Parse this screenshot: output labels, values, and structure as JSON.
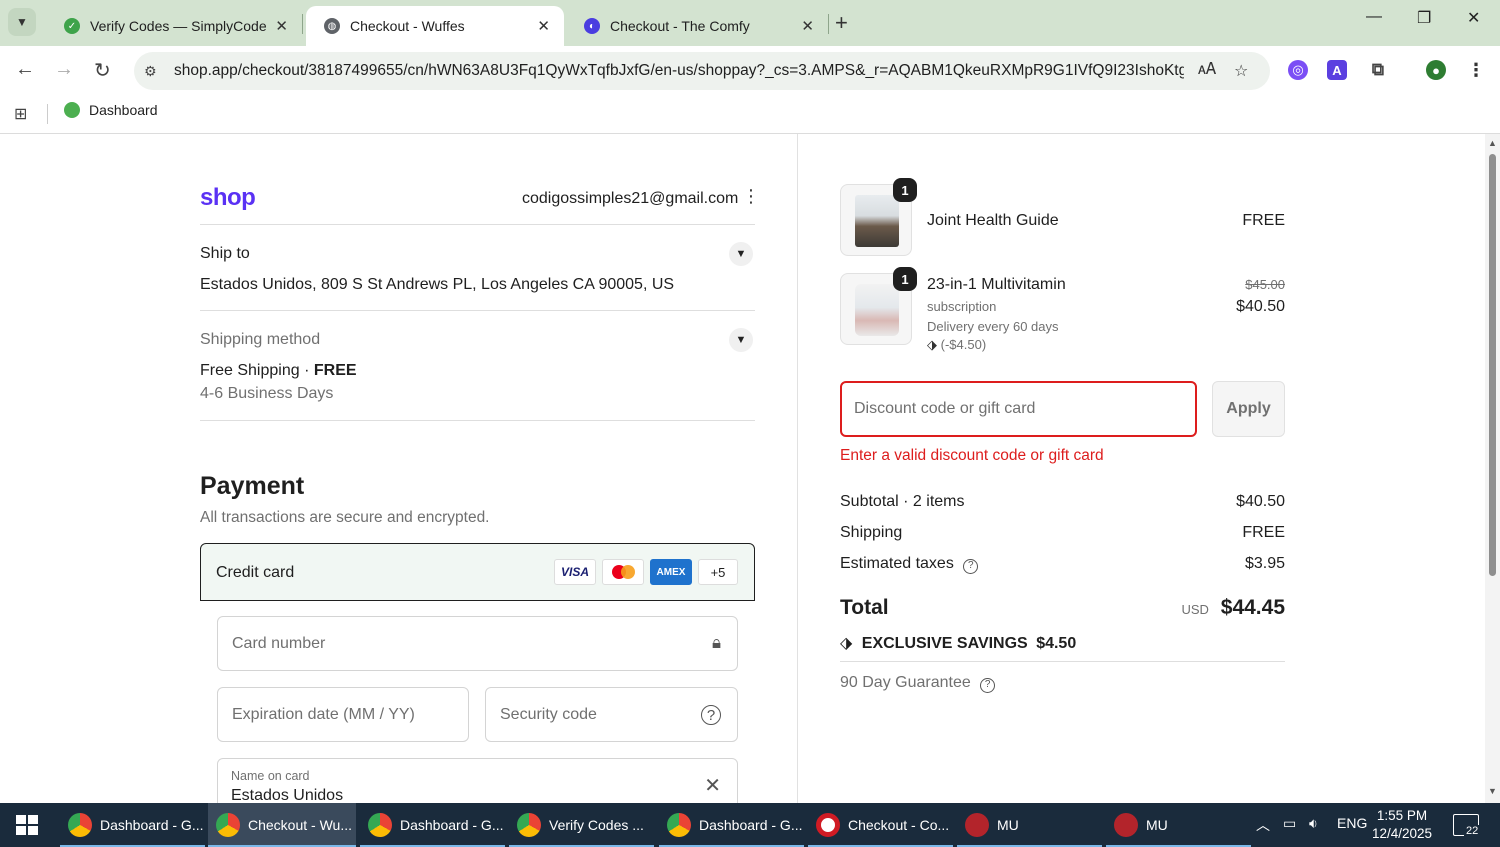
{
  "browser": {
    "tabs": [
      {
        "title": "Verify Codes — SimplyCodes",
        "icon": "simplycodes-favicon",
        "active": false
      },
      {
        "title": "Checkout - Wuffes",
        "icon": "globe-favicon",
        "active": true
      },
      {
        "title": "Checkout - The Comfy",
        "icon": "comfy-favicon",
        "active": false
      }
    ],
    "url": "shop.app/checkout/38187499655/cn/hWN63A8U3Fq1QyWxTqfbJxfG/en-us/shoppay?_cs=3.AMPS&_r=AQABM1QkeuRXMpR9G1IVfQ9I23IshoKtga...",
    "bookmarks": [
      {
        "label": "Dashboard"
      }
    ]
  },
  "header": {
    "logo": "shop",
    "email": "codigossimples21@gmail.com"
  },
  "ship_to": {
    "label": "Ship to",
    "address": "Estados Unidos, 809 S St Andrews PL, Los Angeles CA 90005, US"
  },
  "shipping_method": {
    "label": "Shipping method",
    "name": "Free Shipping",
    "separator": "·",
    "price": "FREE",
    "eta": "4-6 Business Days"
  },
  "payment": {
    "title": "Payment",
    "subtitle": "All transactions are secure and encrypted.",
    "method_label": "Credit card",
    "card_brands": [
      "VISA",
      "",
      "AMEX",
      "+5"
    ],
    "card_number_placeholder": "Card number",
    "expiry_placeholder": "Expiration date (MM / YY)",
    "security_placeholder": "Security code",
    "name_label": "Name on card",
    "name_value": "Estados Unidos"
  },
  "order": {
    "items": [
      {
        "qty": "1",
        "name": "Joint Health Guide",
        "price": "FREE"
      },
      {
        "qty": "1",
        "name": "23-in-1 Multivitamin",
        "subtitle": "subscription",
        "delivery": "Delivery every 60 days",
        "discount": "(-$4.50)",
        "original_price": "$45.00",
        "price": "$40.50"
      }
    ],
    "discount_placeholder": "Discount code or gift card",
    "apply_label": "Apply",
    "error": "Enter a valid discount code or gift card",
    "subtotal_label": "Subtotal · 2 items",
    "subtotal": "$40.50",
    "shipping_label": "Shipping",
    "shipping": "FREE",
    "taxes_label": "Estimated taxes",
    "taxes": "$3.95",
    "total_label": "Total",
    "currency": "USD",
    "total": "$44.45",
    "savings_label": "EXCLUSIVE SAVINGS",
    "savings": "$4.50",
    "guarantee": "90 Day Guarantee"
  },
  "taskbar": {
    "items": [
      {
        "label": "Dashboard - G..."
      },
      {
        "label": "Checkout - Wu..."
      },
      {
        "label": "Dashboard - G..."
      },
      {
        "label": "Verify Codes ..."
      },
      {
        "label": "Dashboard - G..."
      },
      {
        "label": "Checkout - Co..."
      },
      {
        "label": "MU"
      },
      {
        "label": "MU"
      }
    ],
    "language": "ENG",
    "time": "1:55 PM",
    "date": "12/4/2025",
    "notifications": "22"
  },
  "colors": {
    "tabstrip": "#d3e3d0",
    "shop_purple": "#5a31f4",
    "error_red": "#dd1d1d",
    "taskbar": "#1a2b3c"
  }
}
